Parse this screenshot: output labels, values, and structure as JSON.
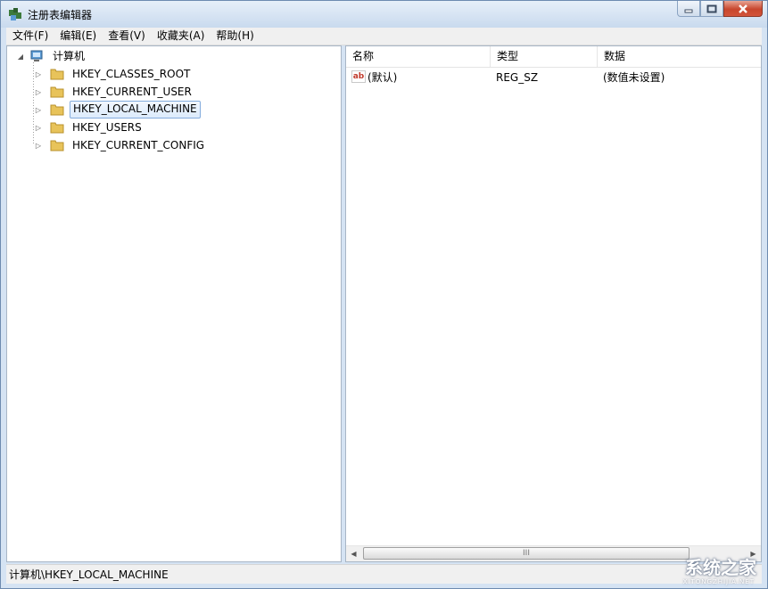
{
  "window": {
    "title": "注册表编辑器"
  },
  "menu": [
    {
      "label": "文件(F)"
    },
    {
      "label": "编辑(E)"
    },
    {
      "label": "查看(V)"
    },
    {
      "label": "收藏夹(A)"
    },
    {
      "label": "帮助(H)"
    }
  ],
  "tree": {
    "root": "计算机",
    "children": [
      {
        "label": "HKEY_CLASSES_ROOT"
      },
      {
        "label": "HKEY_CURRENT_USER"
      },
      {
        "label": "HKEY_LOCAL_MACHINE",
        "selected": true
      },
      {
        "label": "HKEY_USERS"
      },
      {
        "label": "HKEY_CURRENT_CONFIG"
      }
    ]
  },
  "list": {
    "columns": [
      "名称",
      "类型",
      "数据"
    ],
    "rows": [
      {
        "name": "(默认)",
        "type": "REG_SZ",
        "data": "(数值未设置)",
        "icon": "ab-icon"
      }
    ]
  },
  "scrollbar": {
    "grip": "III"
  },
  "status": {
    "path": "计算机\\HKEY_LOCAL_MACHINE"
  },
  "watermark": {
    "text": "系统之家",
    "sub": "XITONGZHIJIA.NET"
  },
  "colors": {
    "selection": "#dcebfc",
    "title_gradient": "#c9daee",
    "close": "#c8462d",
    "folder": "#e8c35a"
  }
}
